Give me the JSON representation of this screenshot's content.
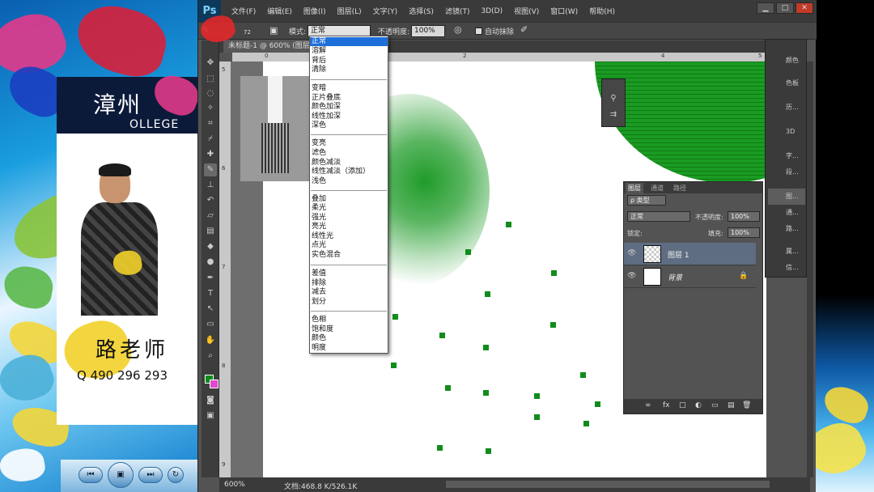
{
  "app": {
    "logo": "Ps",
    "menu": [
      "文件(F)",
      "编辑(E)",
      "图像(I)",
      "图层(L)",
      "文字(Y)",
      "选择(S)",
      "滤镜(T)",
      "3D(D)",
      "视图(V)",
      "窗口(W)",
      "帮助(H)"
    ],
    "window_controls": [
      "▁",
      "□",
      "✕"
    ]
  },
  "options_bar": {
    "brush_size": "72",
    "mode_label": "模式:",
    "mode_value": "正常",
    "opacity_label": "不透明度:",
    "opacity_value": "100%",
    "auto_erase_label": "自动抹除"
  },
  "document": {
    "tab_title": "未标题-1 @ 600% (图层",
    "zoom": "600%",
    "doc_info": "文档:468.8 K/526.1K",
    "ruler_top": [
      "0",
      "2",
      "4",
      "5"
    ],
    "ruler_left": [
      "5",
      "6",
      "7",
      "8",
      "9"
    ]
  },
  "mode_dropdown": {
    "groups": [
      [
        "正常",
        "溶解",
        "背后",
        "清除"
      ],
      [
        "变暗",
        "正片叠底",
        "颜色加深",
        "线性加深",
        "深色"
      ],
      [
        "变亮",
        "滤色",
        "颜色减淡",
        "线性减淡（添加）",
        "浅色"
      ],
      [
        "叠加",
        "柔光",
        "强光",
        "亮光",
        "线性光",
        "点光",
        "实色混合"
      ],
      [
        "差值",
        "排除",
        "减去",
        "划分"
      ],
      [
        "色相",
        "饱和度",
        "颜色",
        "明度"
      ]
    ]
  },
  "dock": {
    "items": [
      "颜色",
      "色板",
      "历...",
      "3D",
      "字...",
      "段...",
      "图...",
      "通...",
      "路...",
      "属...",
      "信..."
    ]
  },
  "layers_panel": {
    "tabs": [
      "图层",
      "通道",
      "路径"
    ],
    "filter_label": "ρ 类型",
    "blend_mode": "正常",
    "opacity_label": "不透明度:",
    "opacity_value": "100%",
    "lock_label": "锁定:",
    "fill_label": "填充:",
    "fill_value": "100%",
    "layers": [
      {
        "name": "图层 1",
        "selected": true
      },
      {
        "name": "背景",
        "selected": false,
        "locked": true
      }
    ],
    "bottom_icons": [
      "∞",
      "fx",
      "□",
      "◐",
      "▭",
      "▤",
      "🗑"
    ]
  },
  "overlay": {
    "college": "漳州",
    "college_sub": "OLLEGE",
    "teacher_name": "路老师",
    "teacher_phone": "Q    490 296 293"
  },
  "colors": {
    "foreground": "#0a8a1a",
    "background": "#e048d0",
    "highlight": "#1e6fd9"
  }
}
